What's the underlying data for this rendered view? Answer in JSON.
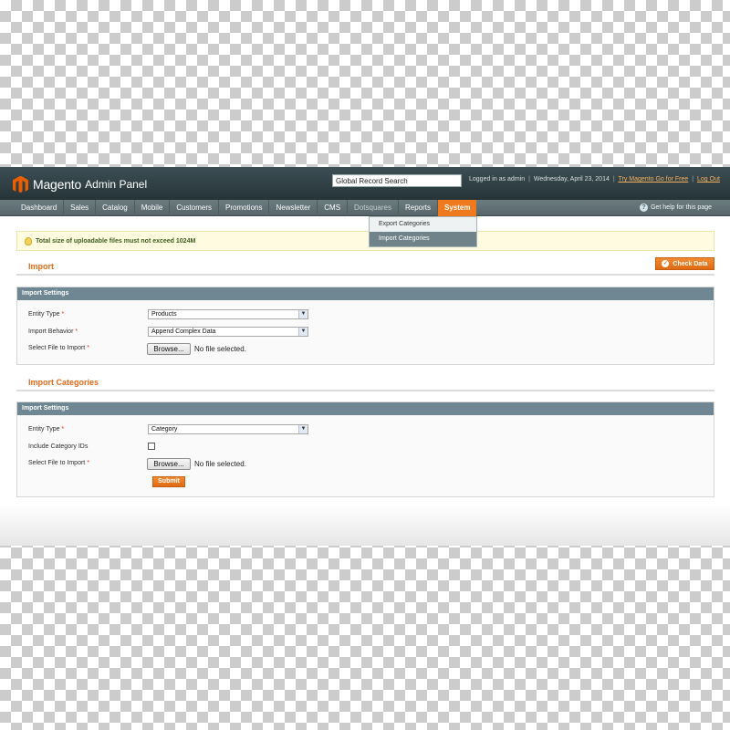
{
  "header": {
    "logo_text": "Magento",
    "logo_sub": "Admin Panel",
    "search_value": "Global Record Search",
    "logged_in": "Logged in as admin",
    "date": "Wednesday, April 23, 2014",
    "try_link": "Try Magento Go for Free",
    "logout": "Log Out",
    "separator": "|"
  },
  "nav": {
    "items": [
      {
        "label": "Dashboard"
      },
      {
        "label": "Sales"
      },
      {
        "label": "Catalog"
      },
      {
        "label": "Mobile"
      },
      {
        "label": "Customers"
      },
      {
        "label": "Promotions"
      },
      {
        "label": "Newsletter"
      },
      {
        "label": "CMS"
      },
      {
        "label": "Dotsquares"
      },
      {
        "label": "Reports"
      },
      {
        "label": "System"
      }
    ],
    "help": "Get help for this page"
  },
  "dropdown": {
    "items": [
      {
        "label": "Export Categories"
      },
      {
        "label": "Import Categories"
      }
    ]
  },
  "notice": "Total size of uploadable files must not exceed 1024M",
  "import": {
    "title": "Import",
    "check_button": "Check Data",
    "fieldset_title": "Import Settings",
    "entity_type_label": "Entity Type",
    "entity_type_value": "Products",
    "behavior_label": "Import Behavior",
    "behavior_value": "Append Complex Data",
    "file_label": "Select File to Import",
    "browse": "Browse...",
    "no_file": "No file selected.",
    "required": "*"
  },
  "import_categories": {
    "title": "Import Categories",
    "fieldset_title": "Import Settings",
    "entity_type_label": "Entity Type",
    "entity_type_value": "Category",
    "include_ids_label": "Include Category IDs",
    "file_label": "Select File to Import",
    "browse": "Browse...",
    "no_file": "No file selected.",
    "submit": "Submit",
    "required": "*"
  },
  "colors": {
    "accent": "#ef7a1d",
    "header_bg": "#2f3f44",
    "fieldset_head": "#6f8792"
  }
}
